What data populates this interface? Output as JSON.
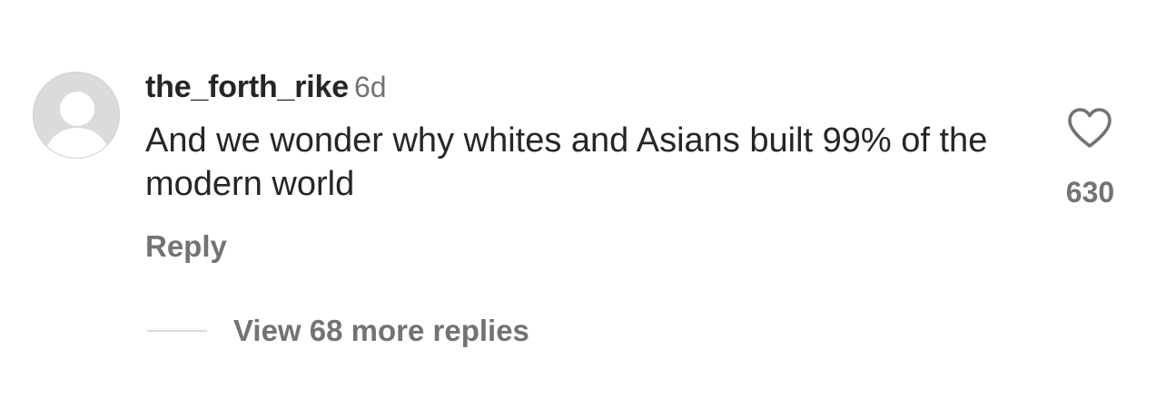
{
  "comment": {
    "username": "the_forth_rike",
    "timestamp": "6d",
    "text": "And we wonder why whites and Asians built 99% of the modern world",
    "reply_label": "Reply",
    "like_count": "630",
    "view_replies_label": "View 68 more replies",
    "avatar_icon": "default-user-avatar-icon",
    "like_icon": "heart-outline-icon"
  },
  "colors": {
    "primary_text": "#262626",
    "secondary_text": "#737373",
    "avatar_bg": "#dbdbdb",
    "divider": "#dbdbdb"
  }
}
